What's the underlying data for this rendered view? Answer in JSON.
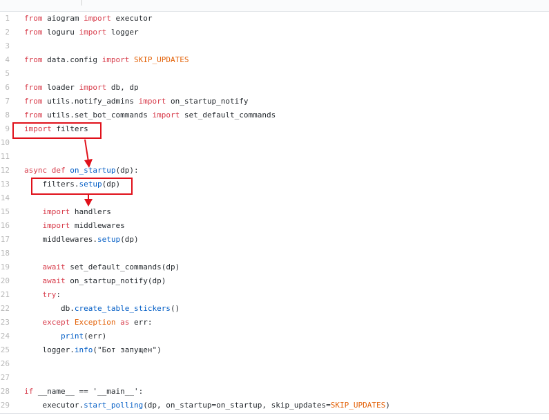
{
  "code_lines": [
    [
      [
        "from",
        "kw"
      ],
      [
        " aiogram ",
        ""
      ],
      [
        "import",
        "kw"
      ],
      [
        " executor",
        ""
      ]
    ],
    [
      [
        "from",
        "kw"
      ],
      [
        " loguru ",
        ""
      ],
      [
        "import",
        "kw"
      ],
      [
        " logger",
        ""
      ]
    ],
    [],
    [
      [
        "from",
        "kw"
      ],
      [
        " data.config ",
        ""
      ],
      [
        "import",
        "kw"
      ],
      [
        " ",
        ""
      ],
      [
        "SKIP_UPDATES",
        "co"
      ]
    ],
    [],
    [
      [
        "from",
        "kw"
      ],
      [
        " loader ",
        ""
      ],
      [
        "import",
        "kw"
      ],
      [
        " db, dp",
        ""
      ]
    ],
    [
      [
        "from",
        "kw"
      ],
      [
        " utils.notify_admins ",
        ""
      ],
      [
        "import",
        "kw"
      ],
      [
        " on_startup_notify",
        ""
      ]
    ],
    [
      [
        "from",
        "kw"
      ],
      [
        " utils.set_bot_commands ",
        ""
      ],
      [
        "import",
        "kw"
      ],
      [
        " set_default_commands",
        ""
      ]
    ],
    [
      [
        "import",
        "kw"
      ],
      [
        " filters",
        ""
      ]
    ],
    [],
    [],
    [
      [
        "async def",
        "kw"
      ],
      [
        " ",
        ""
      ],
      [
        "on_startup",
        "fn"
      ],
      [
        "(dp):",
        ""
      ]
    ],
    [
      [
        "    filters.",
        ""
      ],
      [
        "setup",
        "fn"
      ],
      [
        "(dp)",
        ""
      ]
    ],
    [],
    [
      [
        "    ",
        ""
      ],
      [
        "import",
        "kw"
      ],
      [
        " handlers",
        ""
      ]
    ],
    [
      [
        "    ",
        ""
      ],
      [
        "import",
        "kw"
      ],
      [
        " middlewares",
        ""
      ]
    ],
    [
      [
        "    middlewares.",
        ""
      ],
      [
        "setup",
        "fn"
      ],
      [
        "(dp)",
        ""
      ]
    ],
    [],
    [
      [
        "    ",
        ""
      ],
      [
        "await",
        "kw"
      ],
      [
        " set_default_commands(dp)",
        ""
      ]
    ],
    [
      [
        "    ",
        ""
      ],
      [
        "await",
        "kw"
      ],
      [
        " on_startup_notify(dp)",
        ""
      ]
    ],
    [
      [
        "    ",
        ""
      ],
      [
        "try",
        "kw"
      ],
      [
        ":",
        ""
      ]
    ],
    [
      [
        "        db.",
        ""
      ],
      [
        "create_table_stickers",
        "fn"
      ],
      [
        "()",
        ""
      ]
    ],
    [
      [
        "    ",
        ""
      ],
      [
        "except",
        "kw"
      ],
      [
        " ",
        ""
      ],
      [
        "Exception",
        "co"
      ],
      [
        " ",
        ""
      ],
      [
        "as",
        "kw"
      ],
      [
        " err:",
        ""
      ]
    ],
    [
      [
        "        ",
        ""
      ],
      [
        "print",
        "fn"
      ],
      [
        "(err)",
        ""
      ]
    ],
    [
      [
        "    logger.",
        ""
      ],
      [
        "info",
        "fn"
      ],
      [
        "(\"Бот запущен\")",
        ""
      ]
    ],
    [],
    [],
    [
      [
        "if",
        "kw"
      ],
      [
        " __name__ == '__main__':",
        ""
      ]
    ],
    [
      [
        "    executor.",
        ""
      ],
      [
        "start_polling",
        "fn"
      ],
      [
        "(dp, on_startup=on_startup, skip_updates=",
        ""
      ],
      [
        "SKIP_UPDATES",
        "co"
      ],
      [
        ")",
        ""
      ]
    ]
  ],
  "colors": {
    "annotation": "#e0101a",
    "keyword": "#d73a49",
    "constant": "#e36209",
    "function": "#005cc5"
  }
}
